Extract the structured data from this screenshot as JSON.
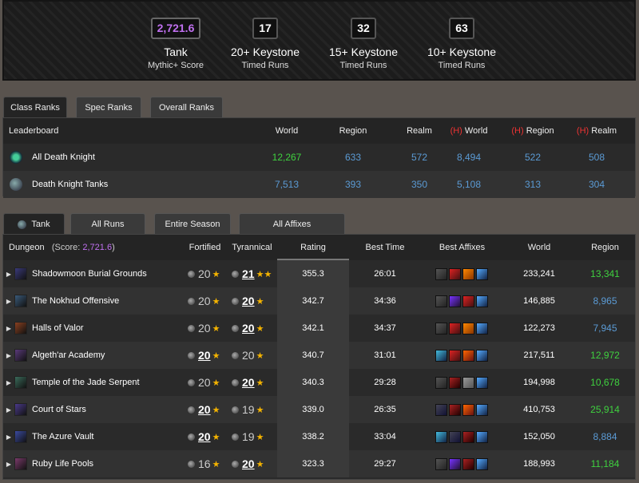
{
  "summary": {
    "score": {
      "value": "2,721.6",
      "title": "Tank",
      "sub": "Mythic+ Score"
    },
    "k20": {
      "value": "17",
      "title": "20+ Keystone",
      "sub": "Timed Runs"
    },
    "k15": {
      "value": "32",
      "title": "15+ Keystone",
      "sub": "Timed Runs"
    },
    "k10": {
      "value": "63",
      "title": "10+ Keystone",
      "sub": "Timed Runs"
    }
  },
  "rank_tabs": [
    "Class Ranks",
    "Spec Ranks",
    "Overall Ranks"
  ],
  "leaderboard": {
    "headers": [
      "Leaderboard",
      "World",
      "Region",
      "Realm",
      "(H)",
      "World",
      "(H)",
      "Region",
      "(H)",
      "Realm"
    ],
    "rows": [
      {
        "name": "All Death Knight",
        "icon": "death-knight-class-icon",
        "world": "12,267",
        "region": "633",
        "realm": "572",
        "hworld": "8,494",
        "hregion": "522",
        "hrealm": "508"
      },
      {
        "name": "Death Knight Tanks",
        "icon": "blood-spec-icon",
        "world": "7,513",
        "region": "393",
        "realm": "350",
        "hworld": "5,108",
        "hregion": "313",
        "hrealm": "304"
      }
    ]
  },
  "dungeon_tabs": [
    "Tank",
    "All Runs",
    "Entire Season",
    "All Affixes"
  ],
  "dungeon_header": {
    "dungeon": "Dungeon",
    "score_prefix": "(Score:",
    "score": "2,721.6",
    "score_suffix": ")",
    "fortified": "Fortified",
    "tyrannical": "Tyrannical",
    "rating": "Rating",
    "best_time": "Best Time",
    "best_affixes": "Best Affixes",
    "world": "World",
    "region": "Region"
  },
  "dungeons": [
    {
      "name": "Shadowmoon Burial Grounds",
      "fort": "20",
      "fort_stars": "★",
      "tyr": "21",
      "tyr_stars": "★★",
      "rating": "355.3",
      "time": "26:01",
      "world": "233,241",
      "region": "13,341"
    },
    {
      "name": "The Nokhud Offensive",
      "fort": "20",
      "fort_stars": "★",
      "tyr": "20",
      "tyr_stars": "★",
      "rating": "342.7",
      "time": "34:36",
      "world": "146,885",
      "region": "8,965"
    },
    {
      "name": "Halls of Valor",
      "fort": "20",
      "fort_stars": "★",
      "tyr": "20",
      "tyr_stars": "★",
      "rating": "342.1",
      "time": "34:37",
      "world": "122,273",
      "region": "7,945"
    },
    {
      "name": "Algeth'ar Academy",
      "fort": "20",
      "fort_stars": "★",
      "tyr": "20",
      "tyr_stars": "★",
      "rating": "340.7",
      "time": "31:01",
      "world": "217,511",
      "region": "12,972"
    },
    {
      "name": "Temple of the Jade Serpent",
      "fort": "20",
      "fort_stars": "★",
      "tyr": "20",
      "tyr_stars": "★",
      "rating": "340.3",
      "time": "29:28",
      "world": "194,998",
      "region": "10,678"
    },
    {
      "name": "Court of Stars",
      "fort": "20",
      "fort_stars": "★",
      "tyr": "19",
      "tyr_stars": "★",
      "rating": "339.0",
      "time": "26:35",
      "world": "410,753",
      "region": "25,914"
    },
    {
      "name": "The Azure Vault",
      "fort": "20",
      "fort_stars": "★",
      "tyr": "19",
      "tyr_stars": "★",
      "rating": "338.2",
      "time": "33:04",
      "world": "152,050",
      "region": "8,884"
    },
    {
      "name": "Ruby Life Pools",
      "fort": "16",
      "fort_stars": "★",
      "tyr": "20",
      "tyr_stars": "★",
      "rating": "323.3",
      "time": "29:27",
      "world": "188,993",
      "region": "11,184"
    }
  ],
  "colors": {
    "score": "#c070f0",
    "rank_blue": "#5b9bd5",
    "rank_green": "#3fd13f",
    "heroic_red": "#e33",
    "star": "#f5b400"
  }
}
